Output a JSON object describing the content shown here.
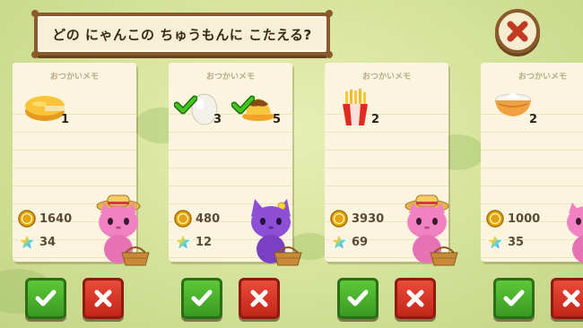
{
  "header": {
    "title": "どの にゃんこの ちゅうもんに こたえる?"
  },
  "close_button": {
    "icon": "close-x-icon"
  },
  "colors": {
    "accept": "#4cb52d",
    "reject": "#d8382a",
    "frame": "#8a5a2c"
  },
  "cards": [
    {
      "memo_title": "おつかいメモ",
      "items": [
        {
          "icon": "cheese-icon",
          "qty": "1",
          "checked": false
        }
      ],
      "coins": "1640",
      "stars": "34",
      "cat": {
        "color": "pink",
        "hat": "straw-hat"
      }
    },
    {
      "memo_title": "おつかいメモ",
      "items": [
        {
          "icon": "eggs-icon",
          "qty": "3",
          "checked": true
        },
        {
          "icon": "pudding-icon",
          "qty": "5",
          "checked": true
        }
      ],
      "coins": "480",
      "stars": "12",
      "cat": {
        "color": "purple",
        "hat": "flower"
      }
    },
    {
      "memo_title": "おつかいメモ",
      "items": [
        {
          "icon": "fries-icon",
          "qty": "2",
          "checked": false
        }
      ],
      "coins": "3930",
      "stars": "69",
      "cat": {
        "color": "pink",
        "hat": "straw-hat"
      }
    },
    {
      "memo_title": "おつかいメモ",
      "items": [
        {
          "icon": "flour-bowl-icon",
          "qty": "2",
          "checked": false
        }
      ],
      "coins": "1000",
      "stars": "35",
      "cat": {
        "color": "pink",
        "hat": "none"
      }
    }
  ]
}
